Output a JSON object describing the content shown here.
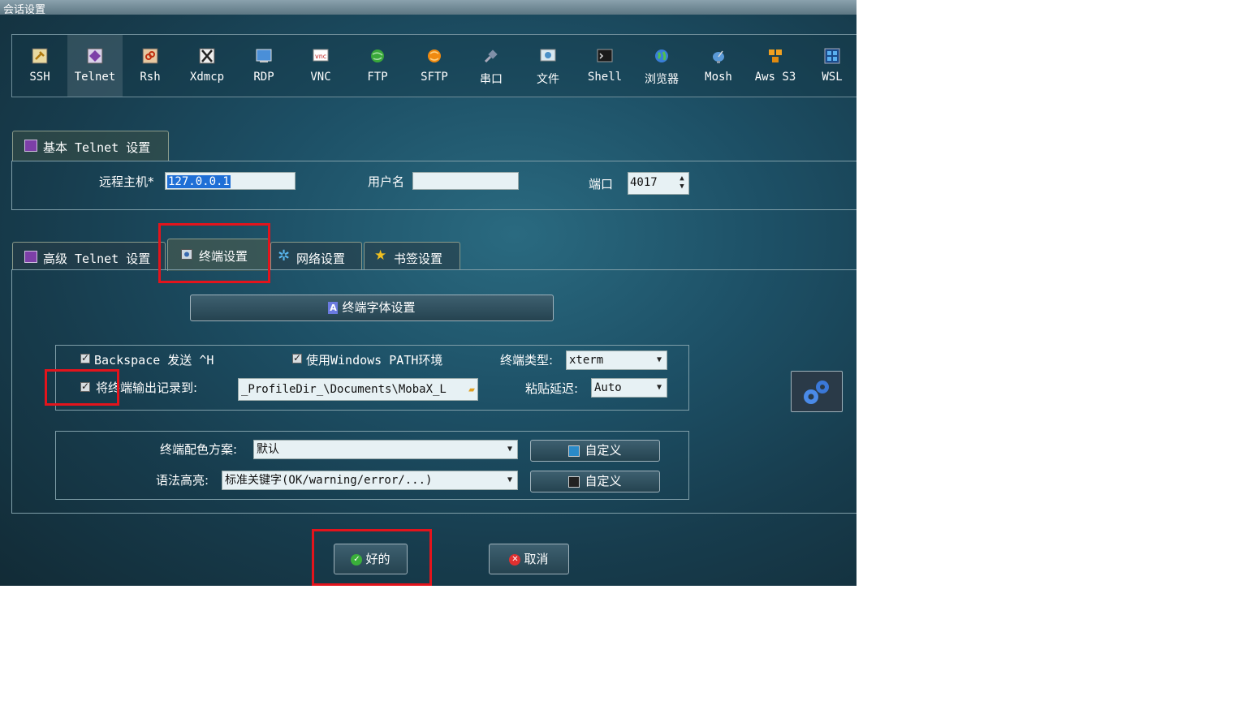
{
  "window": {
    "title": "会话设置"
  },
  "protocols": [
    {
      "label": "SSH",
      "icon": "ssh-key-icon",
      "active": false
    },
    {
      "label": "Telnet",
      "icon": "telnet-icon",
      "active": true
    },
    {
      "label": "Rsh",
      "icon": "rsh-icon",
      "active": false
    },
    {
      "label": "Xdmcp",
      "icon": "xdmcp-icon",
      "active": false
    },
    {
      "label": "RDP",
      "icon": "rdp-icon",
      "active": false
    },
    {
      "label": "VNC",
      "icon": "vnc-icon",
      "active": false
    },
    {
      "label": "FTP",
      "icon": "ftp-globe-icon",
      "active": false
    },
    {
      "label": "SFTP",
      "icon": "sftp-icon",
      "active": false
    },
    {
      "label": "串口",
      "icon": "serial-plug-icon",
      "active": false
    },
    {
      "label": "文件",
      "icon": "file-icon",
      "active": false
    },
    {
      "label": "Shell",
      "icon": "shell-terminal-icon",
      "active": false
    },
    {
      "label": "浏览器",
      "icon": "browser-globe-icon",
      "active": false
    },
    {
      "label": "Mosh",
      "icon": "mosh-dish-icon",
      "active": false
    },
    {
      "label": "Aws S3",
      "icon": "aws-s3-icon",
      "active": false
    },
    {
      "label": "WSL",
      "icon": "wsl-windows-icon",
      "active": false
    }
  ],
  "basic": {
    "tab_label": "基本 Telnet 设置",
    "remote_host_label": "远程主机*",
    "remote_host_value": "127.0.0.1",
    "username_label": "用户名",
    "username_value": "",
    "port_label": "端口",
    "port_value": "4017"
  },
  "tabs": {
    "advanced": "高级 Telnet 设置",
    "terminal": "终端设置",
    "network": "网络设置",
    "bookmark": "书签设置"
  },
  "terminal": {
    "font_button": "终端字体设置",
    "backspace_label": "Backspace 发送 ^H",
    "backspace_checked": true,
    "win_path_label": "使用Windows PATH环境",
    "win_path_checked": true,
    "term_type_label": "终端类型:",
    "term_type_value": "xterm",
    "log_label": "将终端输出记录到:",
    "log_checked": true,
    "log_path": "_ProfileDir_\\Documents\\MobaX_L",
    "paste_delay_label": "粘贴延迟:",
    "paste_delay_value": "Auto",
    "color_scheme_label": "终端配色方案:",
    "color_scheme_value": "默认",
    "custom_label_1": "自定义",
    "syntax_label": "语法高亮:",
    "syntax_value": "标准关键字(OK/warning/error/...)",
    "custom_label_2": "自定义"
  },
  "footer": {
    "ok": "好的",
    "cancel": "取消"
  },
  "colors": {
    "highlight": "#e3141c",
    "bg": "#1d5066"
  }
}
